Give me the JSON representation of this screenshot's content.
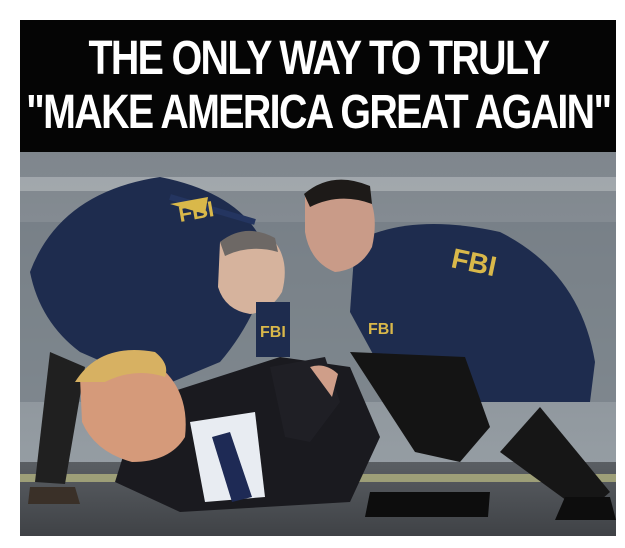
{
  "caption": {
    "line1": "THE ONLY WAY TO TRULY",
    "line2": "\"MAKE AMERICA GREAT AGAIN\""
  },
  "photo": {
    "description": "Two agents in navy windbreakers kneeling over a man in a dark suit lying on the ground",
    "jacket_marks": {
      "agent_left_back": "FBI",
      "agent_left_chest": "FBI",
      "agent_right_back": "FBI",
      "agent_right_chest": "FBI"
    }
  },
  "colors": {
    "caption_bg": "#050505",
    "caption_text": "#ffffff",
    "jacket_navy": "#1e2c4e",
    "jacket_lettering": "#d9b84a",
    "ground": "#4a4d52",
    "sky": "#8d949b"
  }
}
